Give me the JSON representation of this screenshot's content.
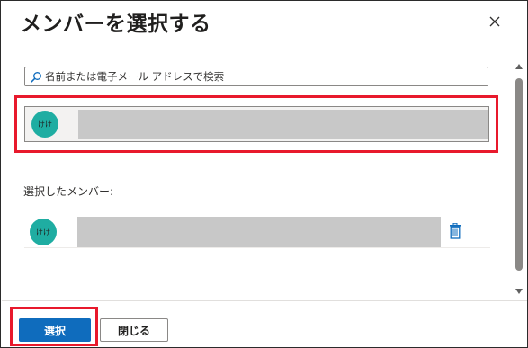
{
  "dialog": {
    "title": "メンバーを選択する"
  },
  "search": {
    "placeholder": "名前または電子メール アドレスで検索"
  },
  "results": [
    {
      "avatar_initials": "けけ"
    }
  ],
  "selected": {
    "label": "選択したメンバー:",
    "members": [
      {
        "avatar_initials": "けけ"
      }
    ]
  },
  "footer": {
    "select_label": "選択",
    "close_label": "閉じる"
  },
  "colors": {
    "avatar": "#1fada2",
    "primary": "#0f6cbd",
    "highlight": "#e8192c"
  },
  "icons": {
    "close": "close-icon",
    "search": "search-icon",
    "delete": "trash-icon"
  }
}
